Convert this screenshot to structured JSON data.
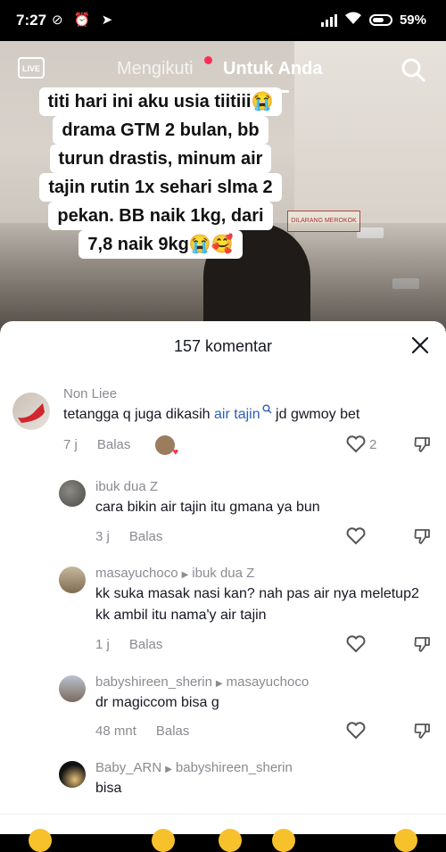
{
  "status_bar": {
    "time": "7:27",
    "icons": "⊘ ⏰ ➤",
    "battery_pct": "59%"
  },
  "top_nav": {
    "live_label": "LIVE",
    "tab_following": "Mengikuti",
    "tab_for_you": "Untuk Anda"
  },
  "video": {
    "caption_lines": [
      "titi hari ini aku usia tiitiii😭",
      "drama GTM 2 bulan, bb",
      "turun drastis, minum air",
      "tajin rutin 1x sehari slma 2",
      "pekan. BB naik 1kg, dari",
      "7,8 naik 9kg😭🥰"
    ],
    "sign_text": "DILARANG MEROKOK"
  },
  "comments_sheet": {
    "title": "157 komentar",
    "comments": [
      {
        "user": "Non Liee",
        "reply_to": "",
        "text_before": "tetangga q juga dikasih ",
        "keyword": "air tajin",
        "text_after": " jd gwmoy bet",
        "age": "7 j",
        "reply_label": "Balas",
        "likes": "2"
      },
      {
        "user": "ibuk dua Z",
        "reply_to": "",
        "text": "cara bikin air tajin itu gmana ya bun",
        "age": "3 j",
        "reply_label": "Balas",
        "likes": ""
      },
      {
        "user": "masayuchoco",
        "reply_to": "ibuk dua Z",
        "text": "kk suka masak nasi kan? nah pas air nya meletup2 kk ambil itu nama'y air tajin",
        "age": "1 j",
        "reply_label": "Balas",
        "likes": ""
      },
      {
        "user": "babyshireen_sherin",
        "reply_to": "masayuchoco",
        "text": "dr magiccom bisa g",
        "age": "48 mnt",
        "reply_label": "Balas",
        "likes": ""
      },
      {
        "user": "Baby_ARN",
        "reply_to": "babyshireen_sherin",
        "text": "bisa",
        "age": "",
        "reply_label": "",
        "likes": ""
      }
    ]
  },
  "colors": {
    "accent": "#fe2c55",
    "link": "#2b5db9",
    "muted": "#8a8b91",
    "text": "#161823"
  }
}
